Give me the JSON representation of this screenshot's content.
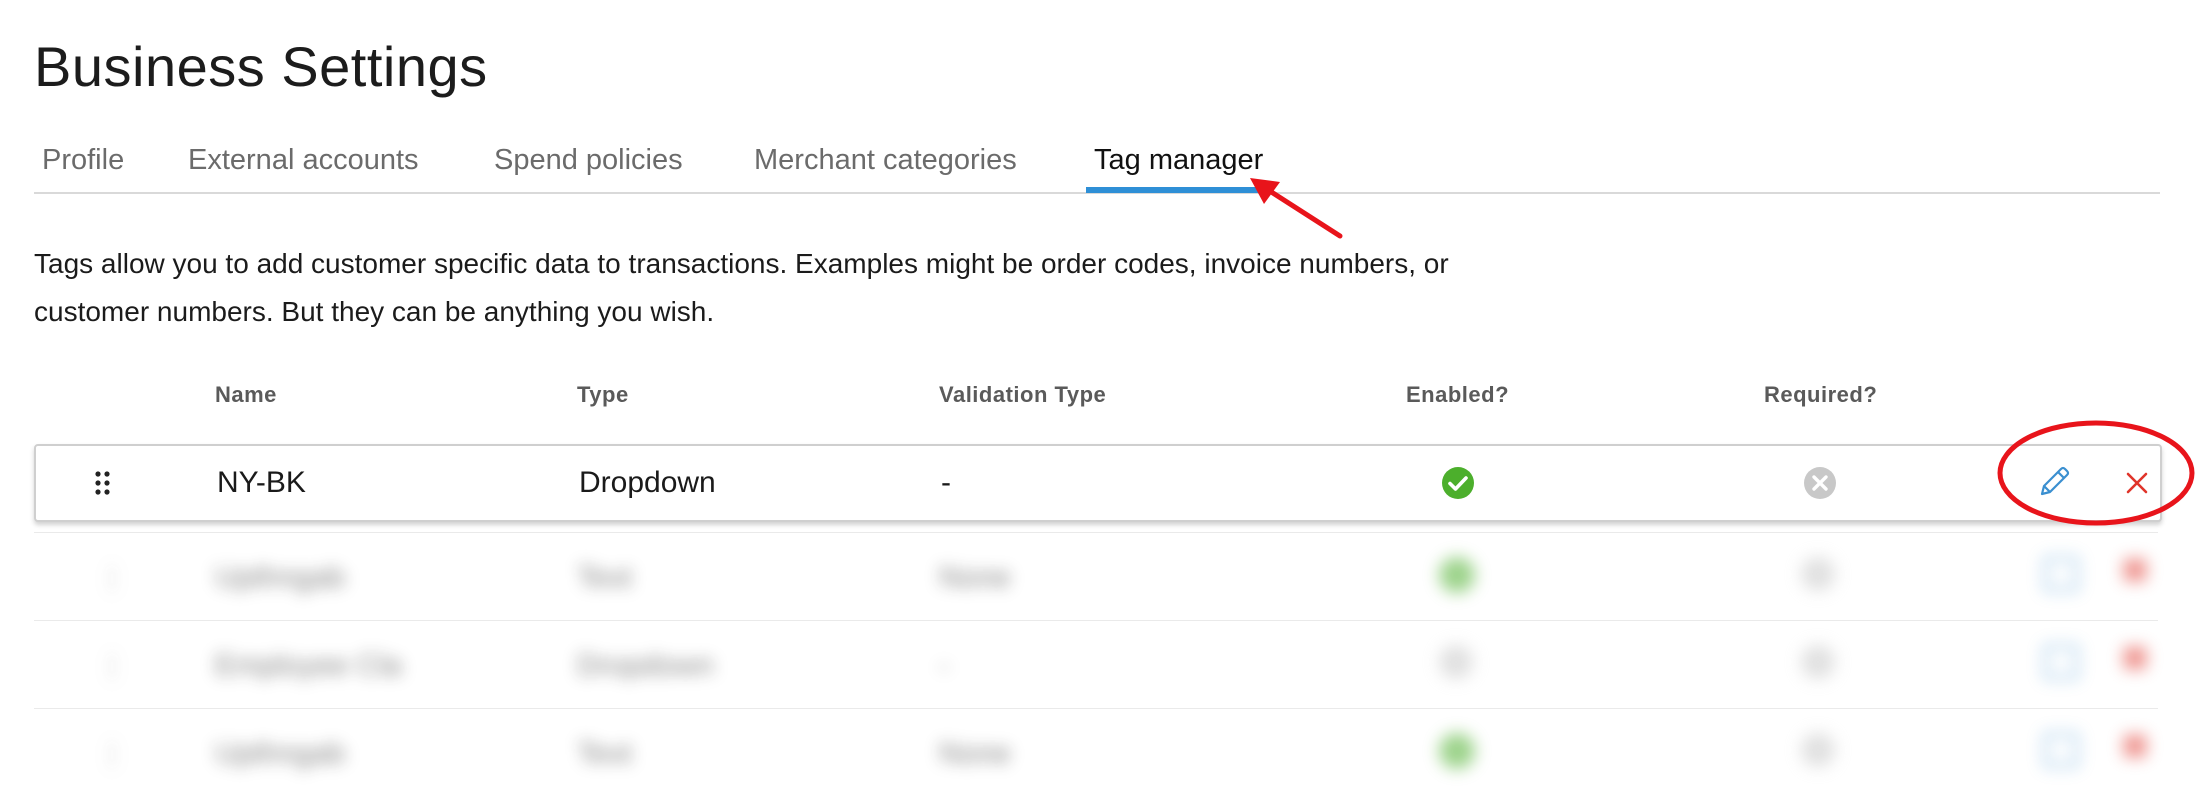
{
  "page": {
    "title": "Business Settings"
  },
  "tabs": [
    {
      "label": "Profile"
    },
    {
      "label": "External accounts"
    },
    {
      "label": "Spend policies"
    },
    {
      "label": "Merchant categories"
    },
    {
      "label": "Tag manager",
      "active": true
    }
  ],
  "description": "Tags allow you to add customer specific data to transactions. Examples might be order codes, invoice numbers, or customer numbers. But they can be anything you wish.",
  "table": {
    "columns": [
      "Name",
      "Type",
      "Validation Type",
      "Enabled?",
      "Required?"
    ],
    "rows": [
      {
        "name": "NY-BK",
        "type": "Dropdown",
        "validation": "-",
        "enabled": true,
        "required": false
      },
      {
        "name": "Upthngab",
        "type": "Text",
        "validation": "None",
        "enabled": true,
        "required": false
      },
      {
        "name": "Employee Cla",
        "type": "Dropdown",
        "validation": "-",
        "enabled": false,
        "required": false
      },
      {
        "name": "Upthngab",
        "type": "Text",
        "validation": "None",
        "enabled": true,
        "required": false
      }
    ]
  },
  "icons": {
    "drag": "drag-handle-icon",
    "edit": "pencil-icon",
    "delete": "close-icon",
    "enabled": "check-circle-icon",
    "disabled": "x-circle-icon"
  },
  "colors": {
    "accent": "#2e8fd6",
    "enabled_green": "#4caf2c",
    "disabled_grey": "#c8c8c8",
    "delete_red": "#e0342a",
    "annotation_red": "#e8141b"
  }
}
